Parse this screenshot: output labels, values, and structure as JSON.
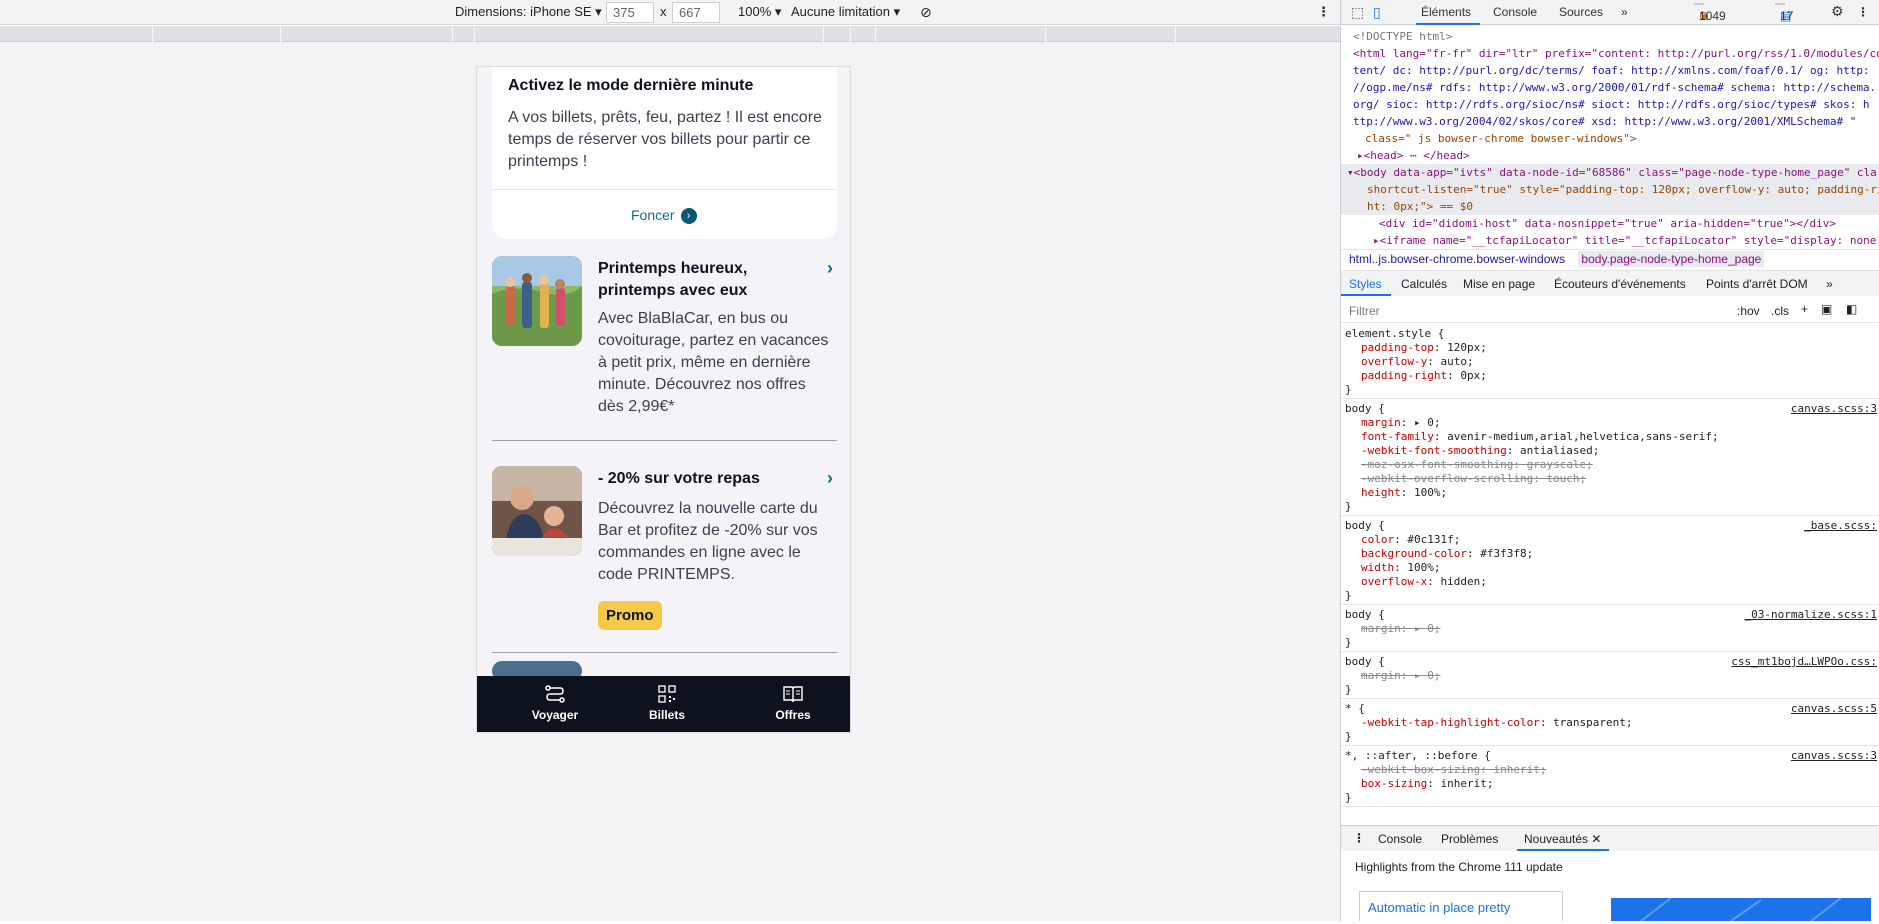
{
  "toolbar": {
    "dimensions": "Dimensions: iPhone SE ▾",
    "width": "375",
    "x": "x",
    "height": "667",
    "zoom": "100% ▾",
    "throttle": "Aucune limitation ▾"
  },
  "phone": {
    "card": {
      "title": "Activez le mode dernière minute",
      "text": "A vos billets, prêts, feu, partez ! Il est encore temps de réserver vos billets pour partir ce printemps !",
      "link": "Foncer"
    },
    "articles": [
      {
        "title": "Printemps heureux, printemps avec eux",
        "text": "Avec BlaBlaCar, en bus ou covoiturage, partez en vacances à petit prix, même en dernière minute. Découvrez nos offres dès 2,99€*"
      },
      {
        "title": "- 20% sur votre repas",
        "text": "Découvrez la nouvelle carte du Bar et profitez de -20% sur vos commandes en ligne avec le code PRINTEMPS.",
        "badge": "Promo"
      }
    ],
    "tabs": [
      "Voyager",
      "Billets",
      "Offres"
    ]
  },
  "devtools": {
    "tabs": [
      "Éléments",
      "Console",
      "Sources",
      "»"
    ],
    "errors": "1",
    "warnings": "1049",
    "messages": "17",
    "dom": [
      "<!DOCTYPE html>",
      "<html lang=\"fr-fr\" dir=\"ltr\" prefix=\"content: http://purl.org/rss/1.0/modules/con",
      "tent/  dc: http://purl.org/dc/terms/  foaf: http://xmlns.com/foaf/0.1/  og: http:",
      "//ogp.me/ns#  rdfs: http://www.w3.org/2000/01/rdf-schema#  schema: http://schema.",
      "org/  sioc: http://rdfs.org/sioc/ns#  sioct: http://rdfs.org/sioc/types#  skos: h",
      "ttp://www.w3.org/2004/02/skos/core#  xsd: http://www.w3.org/2001/XMLSchema# \"",
      "class=\" js bowser-chrome bowser-windows\">",
      "▸<head> ⋯ </head>",
      "▾<body data-app=\"ivts\" data-node-id=\"68586\" class=\"page-node-type-home_page\" cla",
      "shortcut-listen=\"true\" style=\"padding-top: 120px; overflow-y: auto; padding-righ",
      "ht: 0px;\"> == $0",
      "<div id=\"didomi-host\" data-nosnippet=\"true\" aria-hidden=\"true\"></div>",
      "▸<iframe name=\"__tcfapiLocator\" title=\"__tcfapiLocator\" style=\"display: none;\">"
    ],
    "breadcrumb": [
      "html..js.bowser-chrome.bowser-windows",
      "body.page-node-type-home_page"
    ],
    "subtabs": [
      "Styles",
      "Calculés",
      "Mise en page",
      "Écouteurs d'événements",
      "Points d'arrêt DOM",
      "»"
    ],
    "filter": "Filtrer",
    "hov": ":hov",
    "cls": ".cls",
    "rules": [
      {
        "sel": "element.style {",
        "src": "",
        "props": [
          [
            "padding-top",
            "120px;",
            false
          ],
          [
            "overflow-y",
            "auto;",
            false
          ],
          [
            "padding-right",
            "0px;",
            false
          ]
        ]
      },
      {
        "sel": "body {",
        "src": "canvas.scss:3",
        "props": [
          [
            "margin",
            "▸ 0;",
            false
          ],
          [
            "font-family",
            "avenir-medium,arial,helvetica,sans-serif;",
            false
          ],
          [
            "-webkit-font-smoothing",
            "antialiased;",
            false
          ],
          [
            "-moz-osx-font-smoothing",
            "grayscale;",
            true
          ],
          [
            "-webkit-overflow-scrolling",
            "touch;",
            true
          ],
          [
            "height",
            "100%;",
            false
          ]
        ]
      },
      {
        "sel": "body {",
        "src": "_base.scss:",
        "props": [
          [
            "color",
            "#0c131f;",
            false
          ],
          [
            "background-color",
            "#f3f3f8;",
            false
          ],
          [
            "width",
            "100%;",
            false
          ],
          [
            "overflow-x",
            "hidden;",
            false
          ]
        ]
      },
      {
        "sel": "body {",
        "src": "_03-normalize.scss:1",
        "props": [
          [
            "margin",
            "▸ 0;",
            true
          ]
        ]
      },
      {
        "sel": "body {",
        "src": "css_mt1bojd…LWPOo.css:",
        "props": [
          [
            "margin",
            "▸ 0;",
            true
          ]
        ]
      },
      {
        "sel": "* {",
        "src": "canvas.scss:5",
        "props": [
          [
            "-webkit-tap-highlight-color",
            "transparent;",
            false
          ]
        ]
      },
      {
        "sel": "*, ::after, ::before {",
        "src": "canvas.scss:3",
        "props": [
          [
            "-webkit-box-sizing",
            "inherit;",
            true
          ],
          [
            "box-sizing",
            "inherit;",
            false
          ]
        ]
      }
    ],
    "drawer": {
      "tabs": [
        "Console",
        "Problèmes",
        "Nouveautés"
      ],
      "headline": "Highlights from the Chrome 111 update",
      "card": "Automatic in place pretty"
    }
  }
}
